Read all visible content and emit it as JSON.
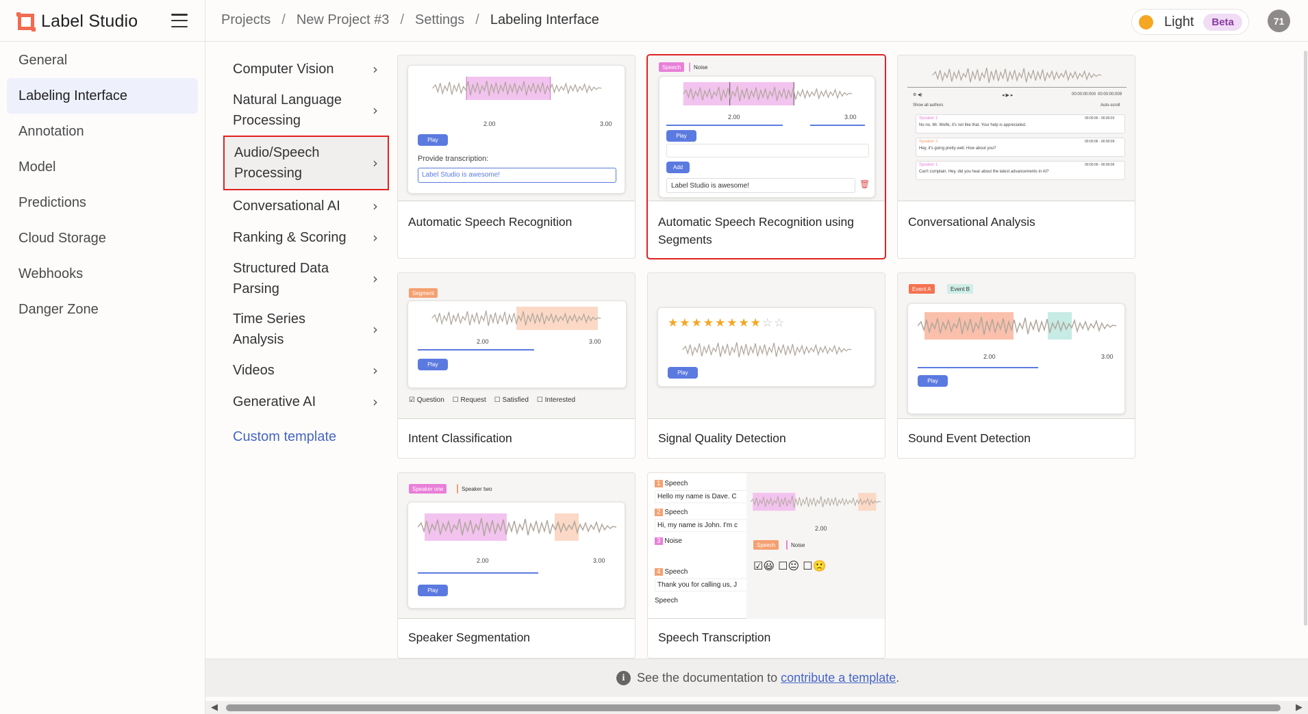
{
  "app": {
    "name": "Label Studio"
  },
  "breadcrumb": [
    "Projects",
    "New Project #3",
    "Settings",
    "Labeling Interface"
  ],
  "breadcrumb_sep": "/",
  "theme": {
    "label": "Light",
    "badge": "Beta"
  },
  "user": {
    "initials": "71"
  },
  "sidebar": {
    "items": [
      {
        "label": "General"
      },
      {
        "label": "Labeling Interface",
        "active": true
      },
      {
        "label": "Annotation"
      },
      {
        "label": "Model"
      },
      {
        "label": "Predictions"
      },
      {
        "label": "Cloud Storage"
      },
      {
        "label": "Webhooks"
      },
      {
        "label": "Danger Zone"
      }
    ]
  },
  "categories": {
    "items": [
      {
        "label": "Computer Vision"
      },
      {
        "label": "Natural Language Processing"
      },
      {
        "label": "Audio/Speech Processing",
        "selected": true
      },
      {
        "label": "Conversational AI"
      },
      {
        "label": "Ranking & Scoring"
      },
      {
        "label": "Structured Data Parsing"
      },
      {
        "label": "Time Series Analysis"
      },
      {
        "label": "Videos"
      },
      {
        "label": "Generative AI"
      }
    ],
    "custom": "Custom template"
  },
  "templates": [
    {
      "title": "Automatic Speech Recognition",
      "prompt": "Provide transcription:",
      "input": "Label Studio is awesome!",
      "play": "Play",
      "t1": "2.00",
      "t2": "3.00"
    },
    {
      "title": "Automatic Speech Recognition using Segments",
      "tag1": "Speech",
      "tag2": "Noise",
      "add": "Add",
      "text": "Label Studio is awesome!",
      "play": "Play",
      "t1": "2.00",
      "t2": "3.00"
    },
    {
      "title": "Conversational Analysis",
      "show": "Show all authors",
      "auto": "Auto-scroll",
      "time": "00:00:00:000",
      "time2": "00:00:00:009",
      "msgs": [
        {
          "speaker": "Speaker 1",
          "text": "No no, Mr. Wolfe, it's not like that. Your help is appreciated.",
          "ts": "00:00:00 - 00:00:03"
        },
        {
          "speaker": "Speaker 2",
          "text": "Hey, it's going pretty well. How about you?",
          "ts": "00:00:06 - 00:00:09"
        },
        {
          "speaker": "Speaker 1",
          "text": "Can't complain. Hey, did you hear about the latest advancements in AI?",
          "ts": "00:00:09 - 00:00:06"
        }
      ]
    },
    {
      "title": "Intent Classification",
      "tag": "Segment",
      "play": "Play",
      "t1": "2.00",
      "t2": "3.00",
      "checks": [
        "Question",
        "Request",
        "Satisfied",
        "Interested"
      ]
    },
    {
      "title": "Signal Quality Detection",
      "play": "Play"
    },
    {
      "title": "Sound Event Detection",
      "tag1": "Event A",
      "tag2": "Event B",
      "play": "Play",
      "t1": "2.00",
      "t2": "3.00"
    },
    {
      "title": "Speaker Segmentation",
      "tag1": "Speaker one",
      "tag2": "Speaker two",
      "play": "Play",
      "t1": "2.00",
      "t2": "3.00"
    },
    {
      "title": "Speech Transcription",
      "rows": [
        {
          "n": "1",
          "label": "Speech",
          "text": "Hello my name is Dave. C"
        },
        {
          "n": "2",
          "label": "Speech",
          "text": "Hi, my name is John. I'm c"
        },
        {
          "n": "3",
          "label": "Noise",
          "text": ""
        },
        {
          "n": "4",
          "label": "Speech",
          "text": "Thank you for calling us, J"
        }
      ],
      "more": "Speech",
      "tag1": "Speech",
      "tag2": "Noise",
      "t1": "2.00"
    }
  ],
  "footer": {
    "prefix": "See the documentation to",
    "link": "contribute a template",
    "suffix": "."
  },
  "colors": {
    "accent": "#5b7ae0",
    "pink": "#e97fd9",
    "teal": "#4fb5a6",
    "orange": "#f5a070",
    "highlight": "#e02020"
  }
}
